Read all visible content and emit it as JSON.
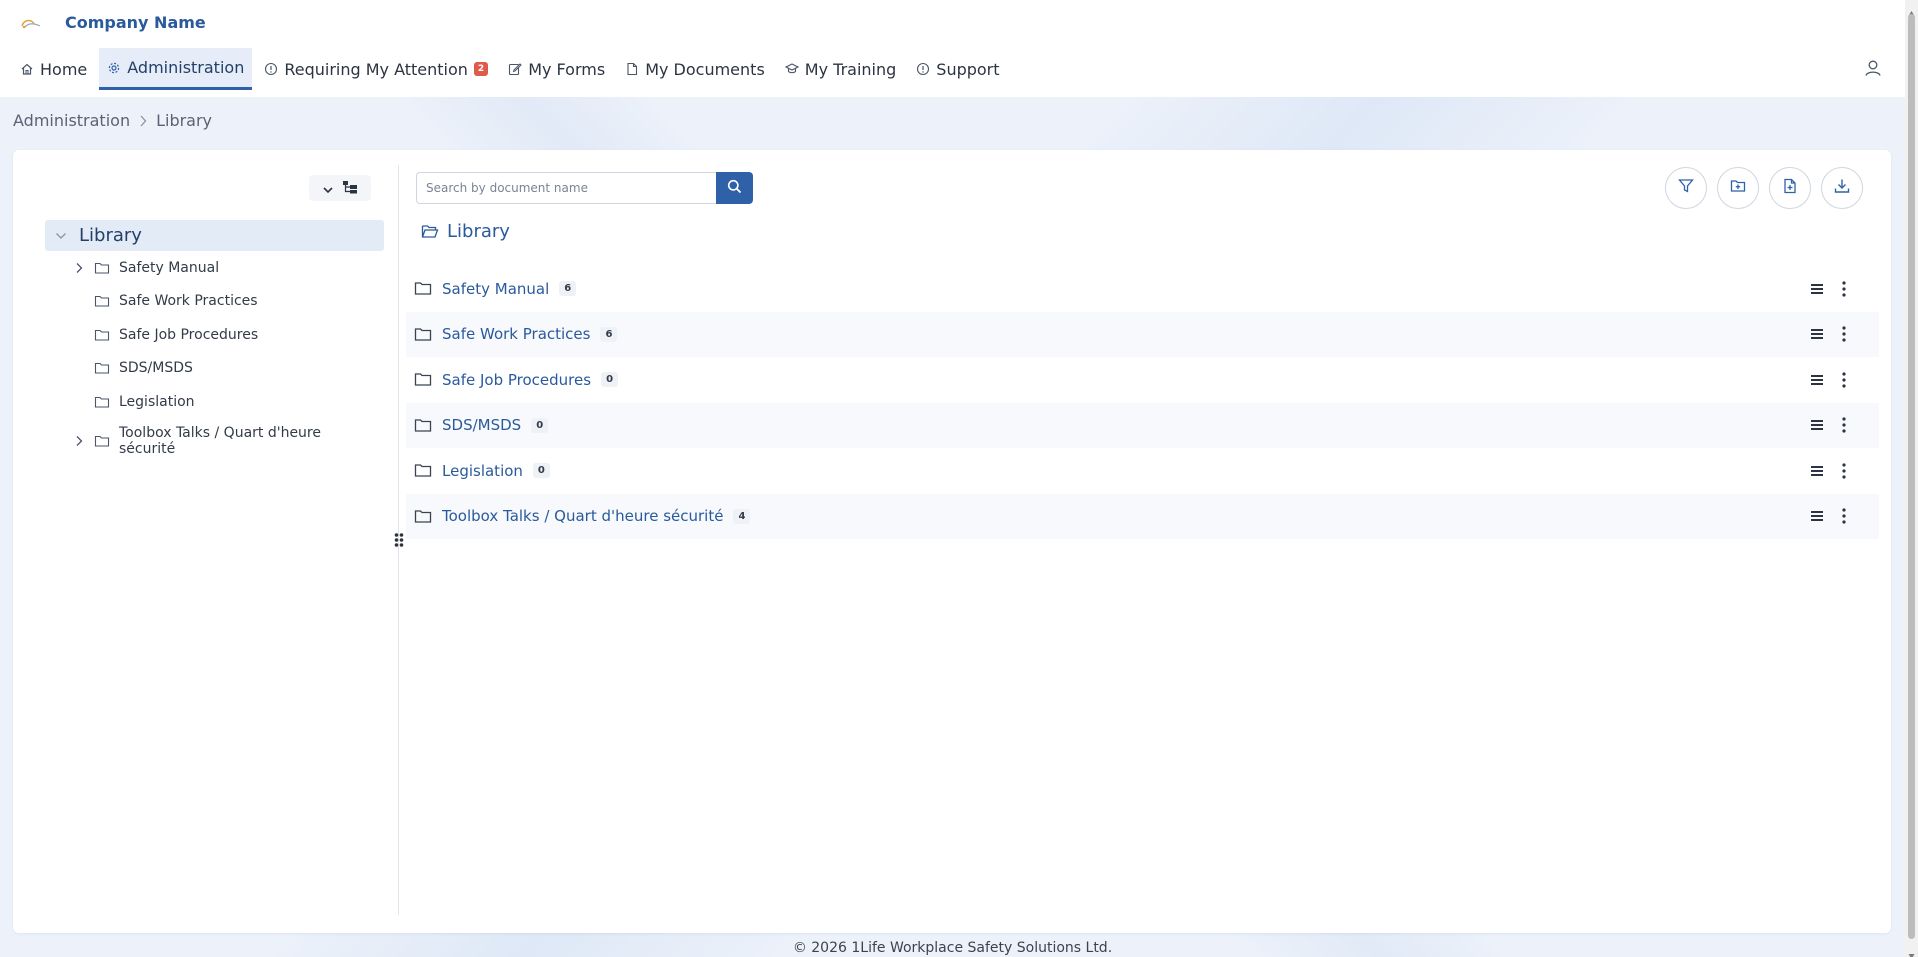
{
  "app": {
    "company_name": "Company Name"
  },
  "nav": {
    "items": [
      {
        "label": "Home",
        "icon": "home-icon",
        "active": false
      },
      {
        "label": "Administration",
        "icon": "gear-icon",
        "active": true
      },
      {
        "label": "Requiring My Attention",
        "icon": "alert-icon",
        "active": false,
        "badge": "2"
      },
      {
        "label": "My Forms",
        "icon": "edit-icon",
        "active": false
      },
      {
        "label": "My Documents",
        "icon": "document-icon",
        "active": false
      },
      {
        "label": "My Training",
        "icon": "graduation-icon",
        "active": false
      },
      {
        "label": "Support",
        "icon": "info-icon",
        "active": false
      }
    ]
  },
  "breadcrumb": {
    "items": [
      "Administration",
      "Library"
    ]
  },
  "tree": {
    "root_label": "Library",
    "items": [
      {
        "label": "Safety Manual",
        "expandable": true
      },
      {
        "label": "Safe Work Practices",
        "expandable": false
      },
      {
        "label": "Safe Job Procedures",
        "expandable": false
      },
      {
        "label": "SDS/MSDS",
        "expandable": false
      },
      {
        "label": "Legislation",
        "expandable": false
      },
      {
        "label": "Toolbox Talks / Quart d'heure sécurité",
        "expandable": true
      }
    ]
  },
  "search": {
    "placeholder": "Search by document name",
    "value": ""
  },
  "toolbar": {
    "buttons": [
      "filter-icon",
      "new-folder-icon",
      "new-document-icon",
      "download-icon"
    ]
  },
  "content": {
    "current_folder": "Library",
    "rows": [
      {
        "name": "Safety Manual",
        "count": "6"
      },
      {
        "name": "Safe Work Practices",
        "count": "6"
      },
      {
        "name": "Safe Job Procedures",
        "count": "0"
      },
      {
        "name": "SDS/MSDS",
        "count": "0"
      },
      {
        "name": "Legislation",
        "count": "0"
      },
      {
        "name": "Toolbox Talks / Quart d'heure sécurité",
        "count": "4"
      }
    ]
  },
  "footer": {
    "text": "© 2026 1Life Workplace Safety Solutions Ltd."
  },
  "colors": {
    "primary": "#2f61a8",
    "link": "#2a5a9c",
    "badge": "#e05a4b",
    "background": "#edf2fa"
  }
}
